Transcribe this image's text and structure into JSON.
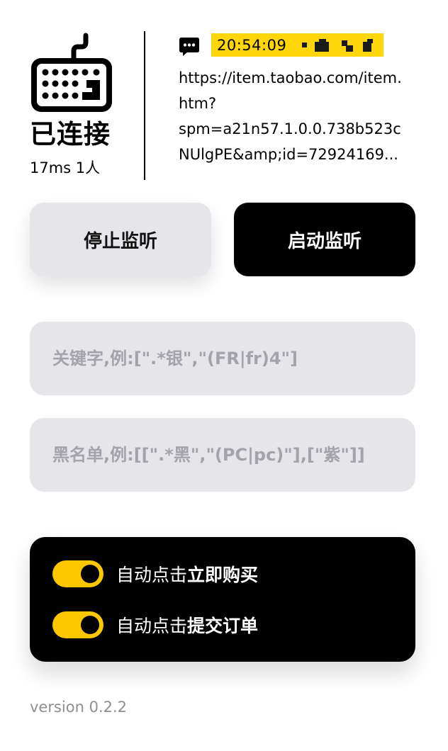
{
  "connection": {
    "status": "已连接",
    "latency_info": "17ms 1人"
  },
  "message": {
    "icon": "chat-bubble-icon",
    "time": "20:54:09",
    "url_lines": [
      "https://item.taobao.com/item.",
      "htm?",
      "spm=a21n57.1.0.0.738b523c",
      "NUlgPE&amp;id=72924169..."
    ]
  },
  "buttons": {
    "stop_label": "停止监听",
    "start_label": "启动监听"
  },
  "filters": {
    "keyword_placeholder": "关键字,例:[\".*银\",\"(FR|fr)4\"]",
    "blacklist_placeholder": "黑名单,例:[[\".*黑\",\"(PC|pc)\"],[\"紫\"]]"
  },
  "options": [
    {
      "prefix": "自动点击",
      "action": "立即购买",
      "enabled": true
    },
    {
      "prefix": "自动点击",
      "action": "提交订单",
      "enabled": true
    }
  ],
  "version": "version 0.2.2",
  "colors": {
    "accent": "#ffc700",
    "badge": "#ffd60a",
    "field_bg": "#e5e5ea",
    "placeholder": "#a3a3ab"
  }
}
